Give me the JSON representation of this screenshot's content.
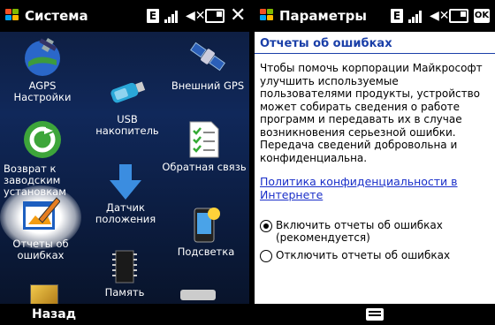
{
  "left": {
    "title": "Система",
    "apps": [
      {
        "label": "AGPS Настройки"
      },
      {
        "label": "USB накопитель"
      },
      {
        "label": "Внешний GPS"
      },
      {
        "label": "Возврат к\nзаводским\nустановкам"
      },
      {
        "label": "Датчик\nположения"
      },
      {
        "label": "Обратная связь"
      },
      {
        "label": "Отчеты об\nошибках"
      },
      {
        "label": "Подсветка"
      },
      {
        "label": "Память"
      }
    ],
    "softkey_left": "Назад"
  },
  "right": {
    "title": "Параметры",
    "ok_label": "OK",
    "page_heading": "Отчеты об ошибках",
    "body_text": "Чтобы помочь корпорации Майкрософт улучшить используемые пользователями продукты, устройство может собирать сведения о работе программ и передавать их в случае возникновения серьезной ошибки. Передача сведений добровольна и конфиденциальна.",
    "privacy_link": "Политика конфиденциальности в Интернете",
    "radio_options": [
      {
        "label": "Включить отчеты об ошибках (рекомендуется)",
        "selected": true
      },
      {
        "label": "Отключить отчеты об ошибках",
        "selected": false
      }
    ]
  },
  "status_icons": [
    "e-icon",
    "signal-icon",
    "speaker-mute-icon",
    "battery-icon"
  ]
}
